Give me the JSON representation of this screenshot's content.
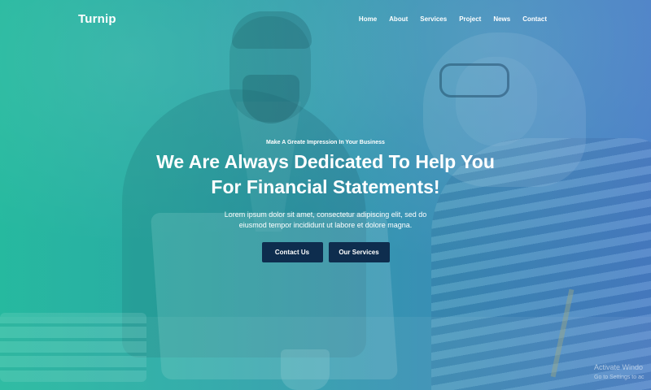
{
  "nav": {
    "brand": "Turnip",
    "items": [
      "Home",
      "About",
      "Services",
      "Project",
      "News",
      "Contact"
    ]
  },
  "hero": {
    "kicker": "Make A Greate Impression In Your Business",
    "title_line1": "We Are Always Dedicated To Help You",
    "title_line2": "For Financial Statements!",
    "lead_line1": "Lorem ipsum dolor sit amet, consectetur adipiscing elit, sed do",
    "lead_line2": "eiusmod tempor incididunt ut labore et dolore magna.",
    "buttons": {
      "contact": "Contact Us",
      "services": "Our Services"
    }
  },
  "watermark": {
    "line1": "Activate Windo",
    "line2": "Go to Settings to ac"
  },
  "colors": {
    "button_bg": "#0e2d4e",
    "gradient_left": "#27b39e",
    "gradient_right": "#4a86c4"
  }
}
